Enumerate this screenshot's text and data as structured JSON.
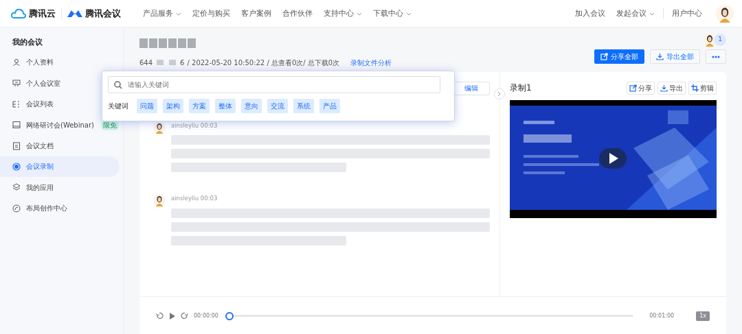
{
  "header": {
    "brand_cloud": "腾讯云",
    "brand_meeting": "腾讯会议",
    "nav": [
      {
        "label": "产品服务",
        "dropdown": true
      },
      {
        "label": "定价与购买",
        "dropdown": false
      },
      {
        "label": "客户案例",
        "dropdown": false
      },
      {
        "label": "合作伙伴",
        "dropdown": false
      },
      {
        "label": "支持中心",
        "dropdown": true
      },
      {
        "label": "下载中心",
        "dropdown": true
      }
    ],
    "right_nav": [
      {
        "label": "加入会议",
        "dropdown": false
      },
      {
        "label": "发起会议",
        "dropdown": true
      },
      {
        "label": "用户中心",
        "dropdown": false
      }
    ]
  },
  "sidebar": {
    "heading": "我的会议",
    "items": [
      {
        "label": "个人资料",
        "selected": false
      },
      {
        "label": "个人会议室",
        "selected": false
      },
      {
        "label": "会议列表",
        "selected": false
      },
      {
        "label": "网络研讨会(Webinar)",
        "selected": false,
        "badge": "限免"
      },
      {
        "label": "会议文档",
        "selected": false
      },
      {
        "label": "会议录制",
        "selected": true
      },
      {
        "label": "我的应用",
        "selected": false
      },
      {
        "label": "布局创作中心",
        "selected": false
      }
    ]
  },
  "recording": {
    "meeting_id_start": "644",
    "meeting_id_end": "6",
    "meta": "/ 2022-05-20 10:50:22  / 总查看0次/ 总下载0次",
    "analysis_link": "录制文件分析",
    "viewer_count": "1",
    "actions": [
      {
        "label": "分享全部",
        "primary": true
      },
      {
        "label": "导出全部",
        "primary": false
      }
    ]
  },
  "transcript": {
    "edit_button": "编辑",
    "entries": [
      {
        "speaker": "ainsleyliu",
        "time": "00:03"
      },
      {
        "speaker": "ainsleyliu",
        "time": "00:03"
      }
    ]
  },
  "keyword_popup": {
    "placeholder": "请输入关键词",
    "label": "关键词",
    "keywords": [
      "问题",
      "架构",
      "方案",
      "整体",
      "意向",
      "交流",
      "系统",
      "产品"
    ]
  },
  "video_panel": {
    "title": "录制1",
    "actions": [
      {
        "label": "分享"
      },
      {
        "label": "导出"
      },
      {
        "label": "剪辑"
      }
    ]
  },
  "player": {
    "current": "00:00:00",
    "total": "00:01:00",
    "speed": "1x",
    "level": 0
  }
}
